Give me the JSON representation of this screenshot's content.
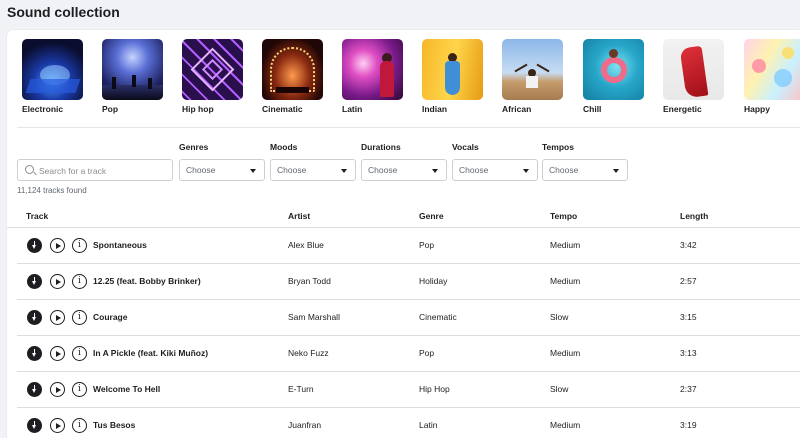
{
  "page": {
    "title": "Sound collection"
  },
  "genres": [
    {
      "label": "Electronic",
      "thumb": "electronic"
    },
    {
      "label": "Pop",
      "thumb": "pop"
    },
    {
      "label": "Hip hop",
      "thumb": "hiphop"
    },
    {
      "label": "Cinematic",
      "thumb": "cinematic"
    },
    {
      "label": "Latin",
      "thumb": "latin"
    },
    {
      "label": "Indian",
      "thumb": "indian"
    },
    {
      "label": "African",
      "thumb": "african"
    },
    {
      "label": "Chill",
      "thumb": "chill"
    },
    {
      "label": "Energetic",
      "thumb": "energetic"
    },
    {
      "label": "Happy",
      "thumb": "happy"
    }
  ],
  "search": {
    "placeholder": "Search for a track",
    "icon": "search-icon"
  },
  "filters": [
    {
      "label": "Genres",
      "value": "Choose"
    },
    {
      "label": "Moods",
      "value": "Choose"
    },
    {
      "label": "Durations",
      "value": "Choose"
    },
    {
      "label": "Vocals",
      "value": "Choose"
    },
    {
      "label": "Tempos",
      "value": "Choose"
    }
  ],
  "tracks_found": "11,124 tracks found",
  "table": {
    "headers": {
      "track": "Track",
      "artist": "Artist",
      "genre": "Genre",
      "tempo": "Tempo",
      "length": "Length"
    },
    "rows": [
      {
        "title": "Spontaneous",
        "artist": "Alex Blue",
        "genre": "Pop",
        "tempo": "Medium",
        "length": "3:42"
      },
      {
        "title": "12.25 (feat. Bobby Brinker)",
        "artist": "Bryan Todd",
        "genre": "Holiday",
        "tempo": "Medium",
        "length": "2:57"
      },
      {
        "title": "Courage",
        "artist": "Sam Marshall",
        "genre": "Cinematic",
        "tempo": "Slow",
        "length": "3:15"
      },
      {
        "title": "In A Pickle (feat. Kiki Muñoz)",
        "artist": "Neko Fuzz",
        "genre": "Pop",
        "tempo": "Medium",
        "length": "3:13"
      },
      {
        "title": "Welcome To Hell",
        "artist": "E-Turn",
        "genre": "Hip Hop",
        "tempo": "Slow",
        "length": "2:37"
      },
      {
        "title": "Tus Besos",
        "artist": "Juanfran",
        "genre": "Latin",
        "tempo": "Medium",
        "length": "3:19"
      }
    ]
  },
  "icons": {
    "download": "download-icon",
    "play": "play-icon",
    "info": "info-icon"
  },
  "colors": {
    "text": "#1c1e21",
    "muted": "#606770",
    "border": "#ccd0d5",
    "background": "#f0f2f5"
  }
}
